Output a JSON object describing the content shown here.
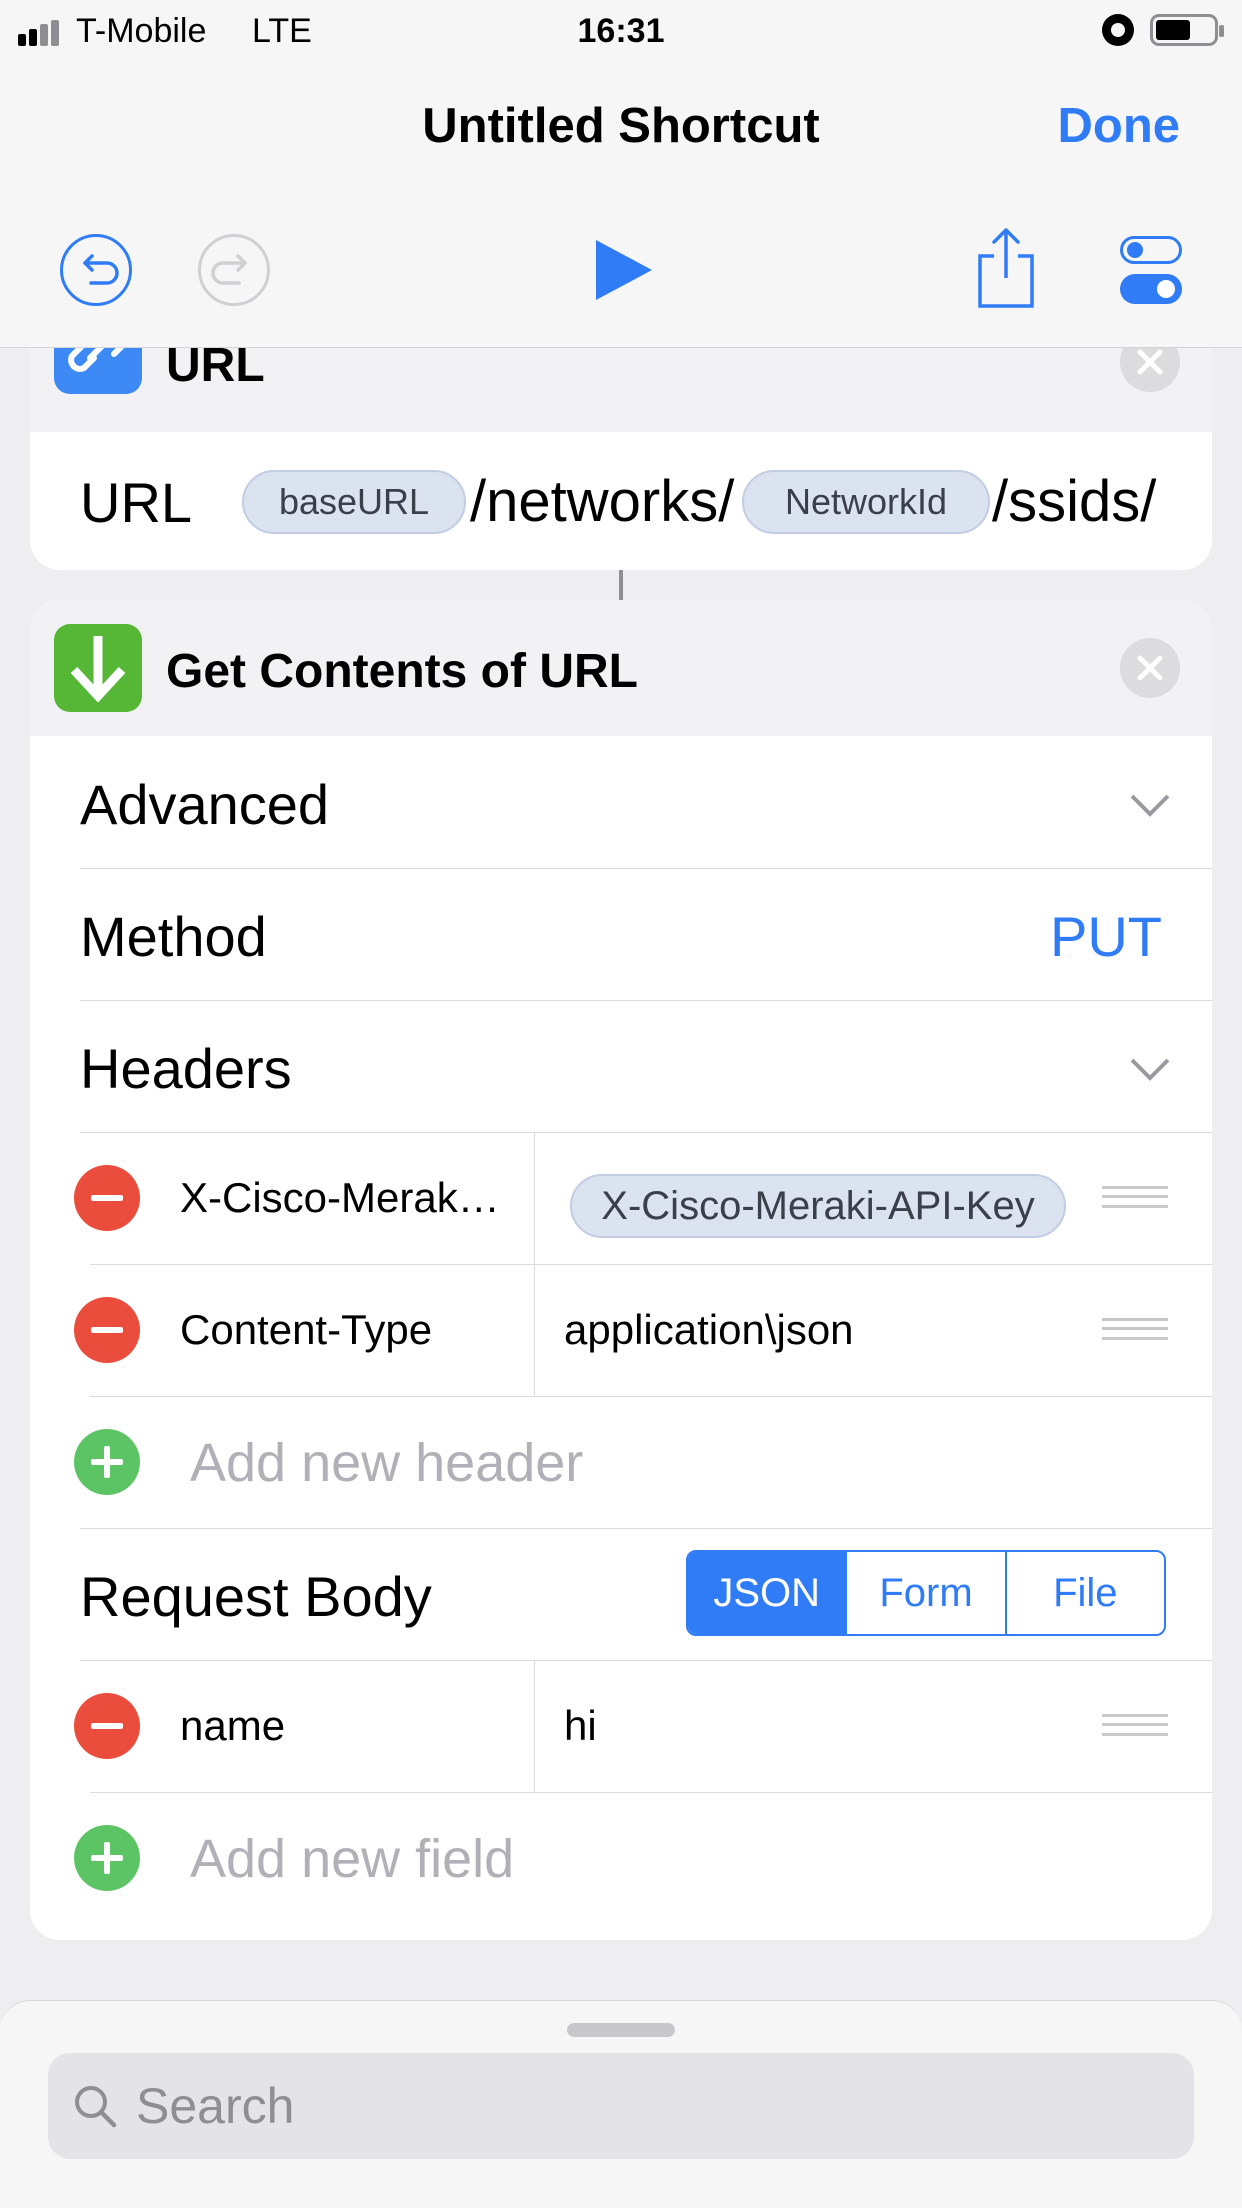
{
  "status": {
    "carrier": "T-Mobile",
    "network": "LTE",
    "time": "16:31"
  },
  "nav": {
    "title": "Untitled Shortcut",
    "done_label": "Done"
  },
  "toolbar": {
    "undo_icon": "undo-icon",
    "redo_icon": "redo-icon",
    "play_icon": "play-icon",
    "share_icon": "share-icon",
    "settings_icon": "toggle-settings-icon"
  },
  "url_action": {
    "title": "URL",
    "icon": "link-icon",
    "field_label": "URL",
    "tokens": [
      {
        "type": "variable",
        "text": "baseURL"
      },
      {
        "type": "text",
        "text": "/networks/"
      },
      {
        "type": "variable",
        "text": "NetworkId"
      },
      {
        "type": "text",
        "text": "/ssids/"
      }
    ]
  },
  "get_contents": {
    "title": "Get Contents of URL",
    "icon": "download-arrow-icon",
    "advanced_label": "Advanced",
    "method_label": "Method",
    "method_value": "PUT",
    "headers_label": "Headers",
    "headers": [
      {
        "key": "X-Cisco-Merak…",
        "value": "X-Cisco-Meraki-API-Key",
        "value_is_variable": true
      },
      {
        "key": "Content-Type",
        "value": "application\\json",
        "value_is_variable": false
      }
    ],
    "add_header_label": "Add new header",
    "request_body_label": "Request Body",
    "body_types": [
      "JSON",
      "Form",
      "File"
    ],
    "selected_body_type": "JSON",
    "fields": [
      {
        "key": "name",
        "value": "hi"
      }
    ],
    "add_field_label": "Add new field"
  },
  "search": {
    "placeholder": "Search"
  },
  "colors": {
    "accent": "#2f7cf6",
    "remove": "#eb4d3d",
    "add": "#5dc466"
  }
}
